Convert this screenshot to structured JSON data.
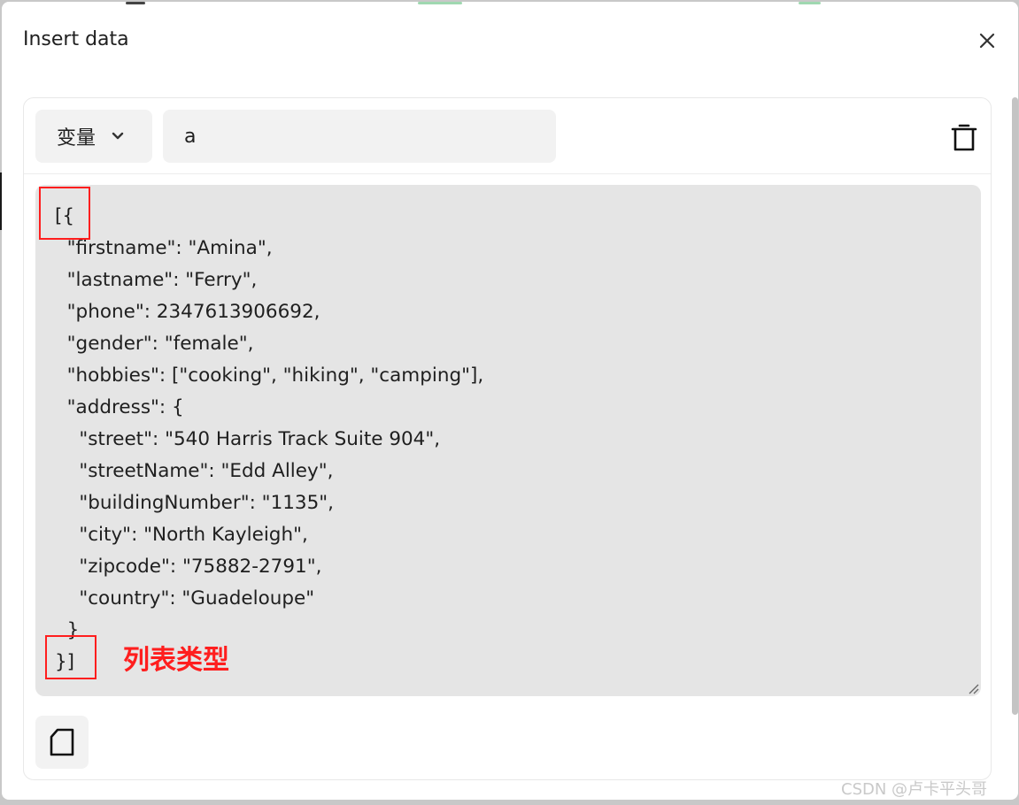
{
  "dialog": {
    "title": "Insert data",
    "close_icon": "close-icon"
  },
  "toolbar": {
    "type_select_label": "变量",
    "type_select_icon": "chevron-down-icon",
    "name_value": "a",
    "delete_icon": "trash-icon"
  },
  "editor": {
    "content": "[{\n  \"firstname\": \"Amina\",\n  \"lastname\": \"Ferry\",\n  \"phone\": 2347613906692,\n  \"gender\": \"female\",\n  \"hobbies\": [\"cooking\", \"hiking\", \"camping\"],\n  \"address\": {\n    \"street\": \"540 Harris Track Suite 904\",\n    \"streetName\": \"Edd Alley\",\n    \"buildingNumber\": \"1135\",\n    \"city\": \"North Kayleigh\",\n    \"zipcode\": \"75882-2791\",\n    \"country\": \"Guadeloupe\"\n  }\n}]"
  },
  "annotation": {
    "label": "列表类型",
    "color": "#ff1e1e"
  },
  "footer": {
    "copy_icon": "copy-icon"
  },
  "watermark": "CSDN @卢卡平头哥"
}
